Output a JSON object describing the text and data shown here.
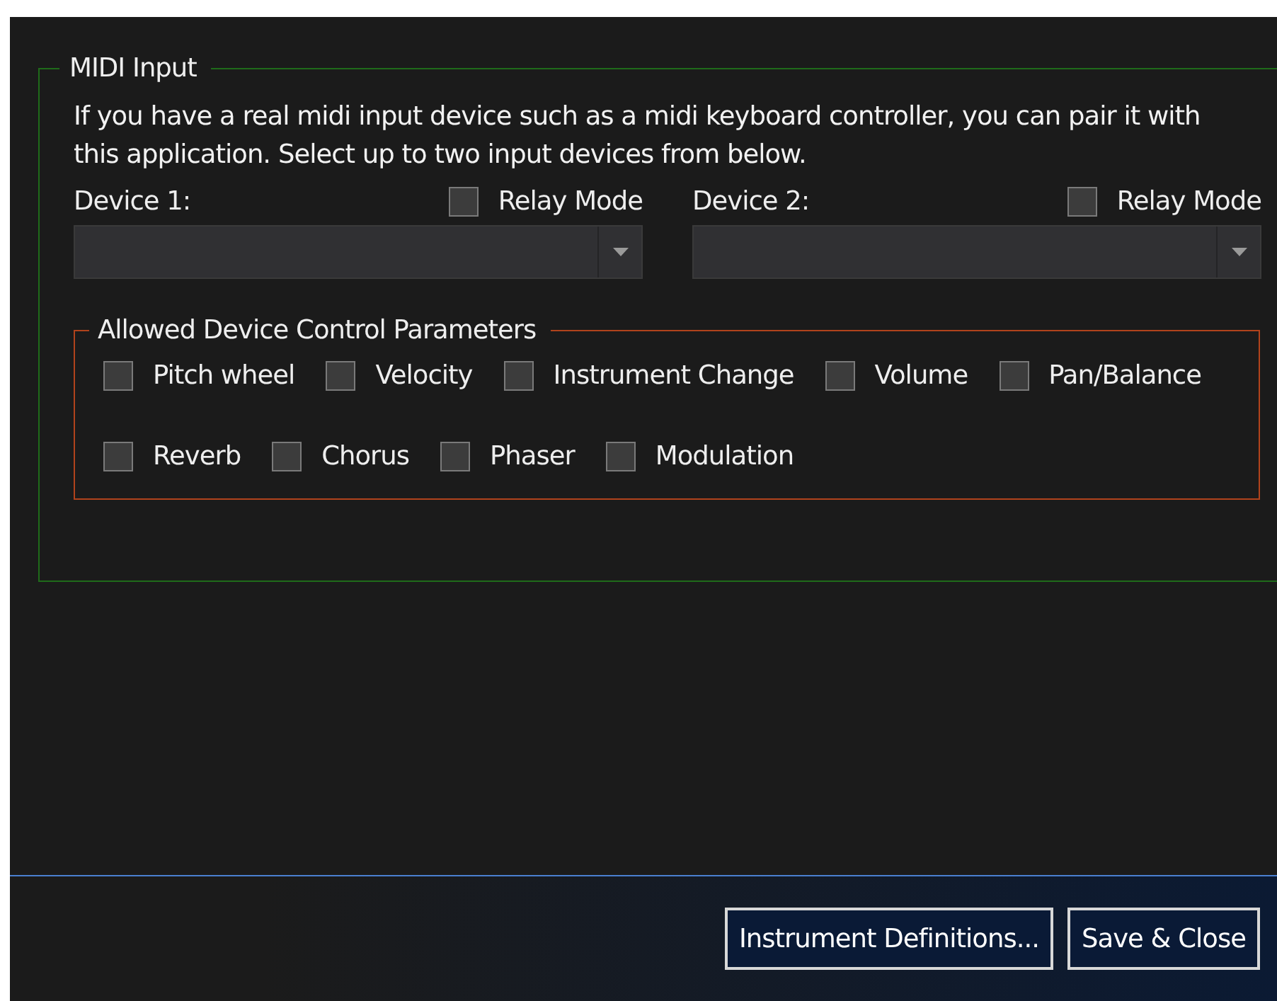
{
  "group": {
    "title": "MIDI Input",
    "description": "If you have a real midi input device such as a midi keyboard controller, you can pair it with this application. Select up to two input devices from below.",
    "devices": [
      {
        "label": "Device 1:",
        "relay_label": "Relay Mode",
        "relay_checked": false
      },
      {
        "label": "Device 2:",
        "relay_label": "Relay Mode",
        "relay_checked": false
      }
    ],
    "parameters": {
      "title": "Allowed Device Control Parameters",
      "options": [
        {
          "label": "Pitch wheel",
          "checked": false
        },
        {
          "label": "Velocity",
          "checked": false
        },
        {
          "label": "Instrument Change",
          "checked": false
        },
        {
          "label": "Volume",
          "checked": false
        },
        {
          "label": "Pan/Balance",
          "checked": false
        },
        {
          "label": "Reverb",
          "checked": false
        },
        {
          "label": "Chorus",
          "checked": false
        },
        {
          "label": "Phaser",
          "checked": false
        },
        {
          "label": "Modulation",
          "checked": false
        }
      ]
    }
  },
  "buttons": [
    "Instrument Definitions...",
    "Save & Close"
  ]
}
